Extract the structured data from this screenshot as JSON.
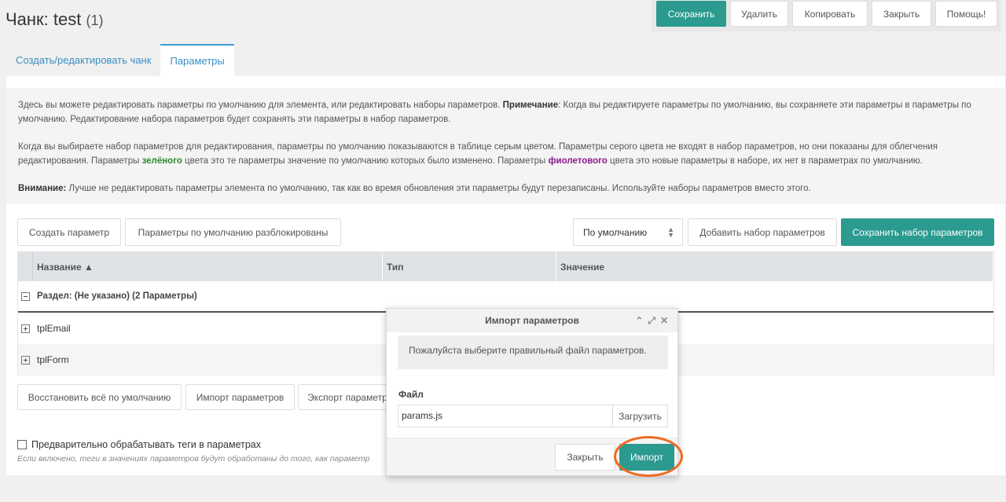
{
  "header": {
    "title": "Чанк: test",
    "count": "(1)",
    "buttons": {
      "save": "Сохранить",
      "delete": "Удалить",
      "copy": "Копировать",
      "close": "Закрыть",
      "help": "Помощь!"
    }
  },
  "tabs": [
    {
      "label": "Создать/редактировать чанк",
      "active": false
    },
    {
      "label": "Параметры",
      "active": true
    }
  ],
  "description": {
    "p1_a": "Здесь вы можете редактировать параметры по умолчанию для элемента, или редактировать наборы параметров. ",
    "p1_note": "Примечание",
    "p1_b": ": Когда вы редактируете параметры по умолчанию, вы сохраняете эти параметры в параметры по умолчанию. Редактирование набора параметров будет сохранять эти параметры в набор параметров.",
    "p2_a": "Когда вы выбираете набор параметров для редактирования, параметры по умолчанию показываются в таблице серым цветом. Параметры серого цвета не входят в набор параметров, но они показаны для облегчения редактирования. Параметры ",
    "p2_green": "зелёного",
    "p2_b": " цвета это те параметры значение по умолчанию которых было изменено. Параметры ",
    "p2_violet": "фиолетового",
    "p2_c": " цвета это новые параметры в наборе, их нет в параметрах по умолчанию.",
    "p3_warn": "Внимание:",
    "p3_text": " Лучше не редактировать параметры элемента по умолчанию, так как во время обновления эти параметры будут перезаписаны. Используйте наборы параметров вместо этого."
  },
  "toolbar": {
    "create_param": "Создать параметр",
    "unlocked": "Параметры по умолчанию разблокированы",
    "set_select": "По умолчанию",
    "add_set": "Добавить набор параметров",
    "save_set": "Сохранить набор параметров"
  },
  "grid": {
    "columns": [
      "Название ▲",
      "Тип",
      "Значение"
    ],
    "group": "Раздел: (Не указано) (2 Параметры)",
    "rows": [
      "tplEmail",
      "tplForm"
    ]
  },
  "bottom": {
    "restore": "Восстановить всё по умолчанию",
    "import": "Импорт параметров",
    "export": "Экспорт параметров"
  },
  "preprocess": {
    "label": "Предварительно обрабатывать теги в параметрах",
    "hint": "Если включено, теги в значениях параметров будут обработаны до того, как параметр"
  },
  "modal": {
    "title": "Импорт параметров",
    "message": "Пожалуйста выберите правильный файл параметров.",
    "file_label": "Файл",
    "file_value": "params.js",
    "upload": "Загрузить",
    "close": "Закрыть",
    "import": "Импорт"
  },
  "colors": {
    "primary": "#2b9a8f",
    "highlight": "#ee6b22"
  }
}
